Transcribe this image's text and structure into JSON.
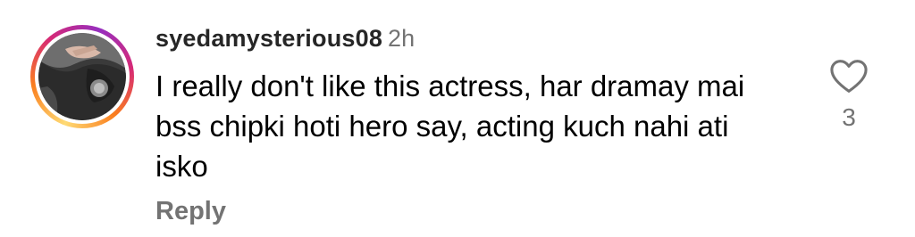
{
  "comment": {
    "username": "syedamysterious08",
    "timestamp": "2h",
    "text": "I really don't like this actress, har dramay mai bss chipki hoti hero say, acting kuch nahi ati isko",
    "reply_label": "Reply",
    "like_count": "3"
  },
  "icons": {
    "like": "heart-outline-icon"
  },
  "colors": {
    "username": "#262626",
    "secondary_text": "#737373",
    "story_ring": [
      "#feda75",
      "#fa7e1e",
      "#d62976",
      "#962fbf"
    ]
  }
}
